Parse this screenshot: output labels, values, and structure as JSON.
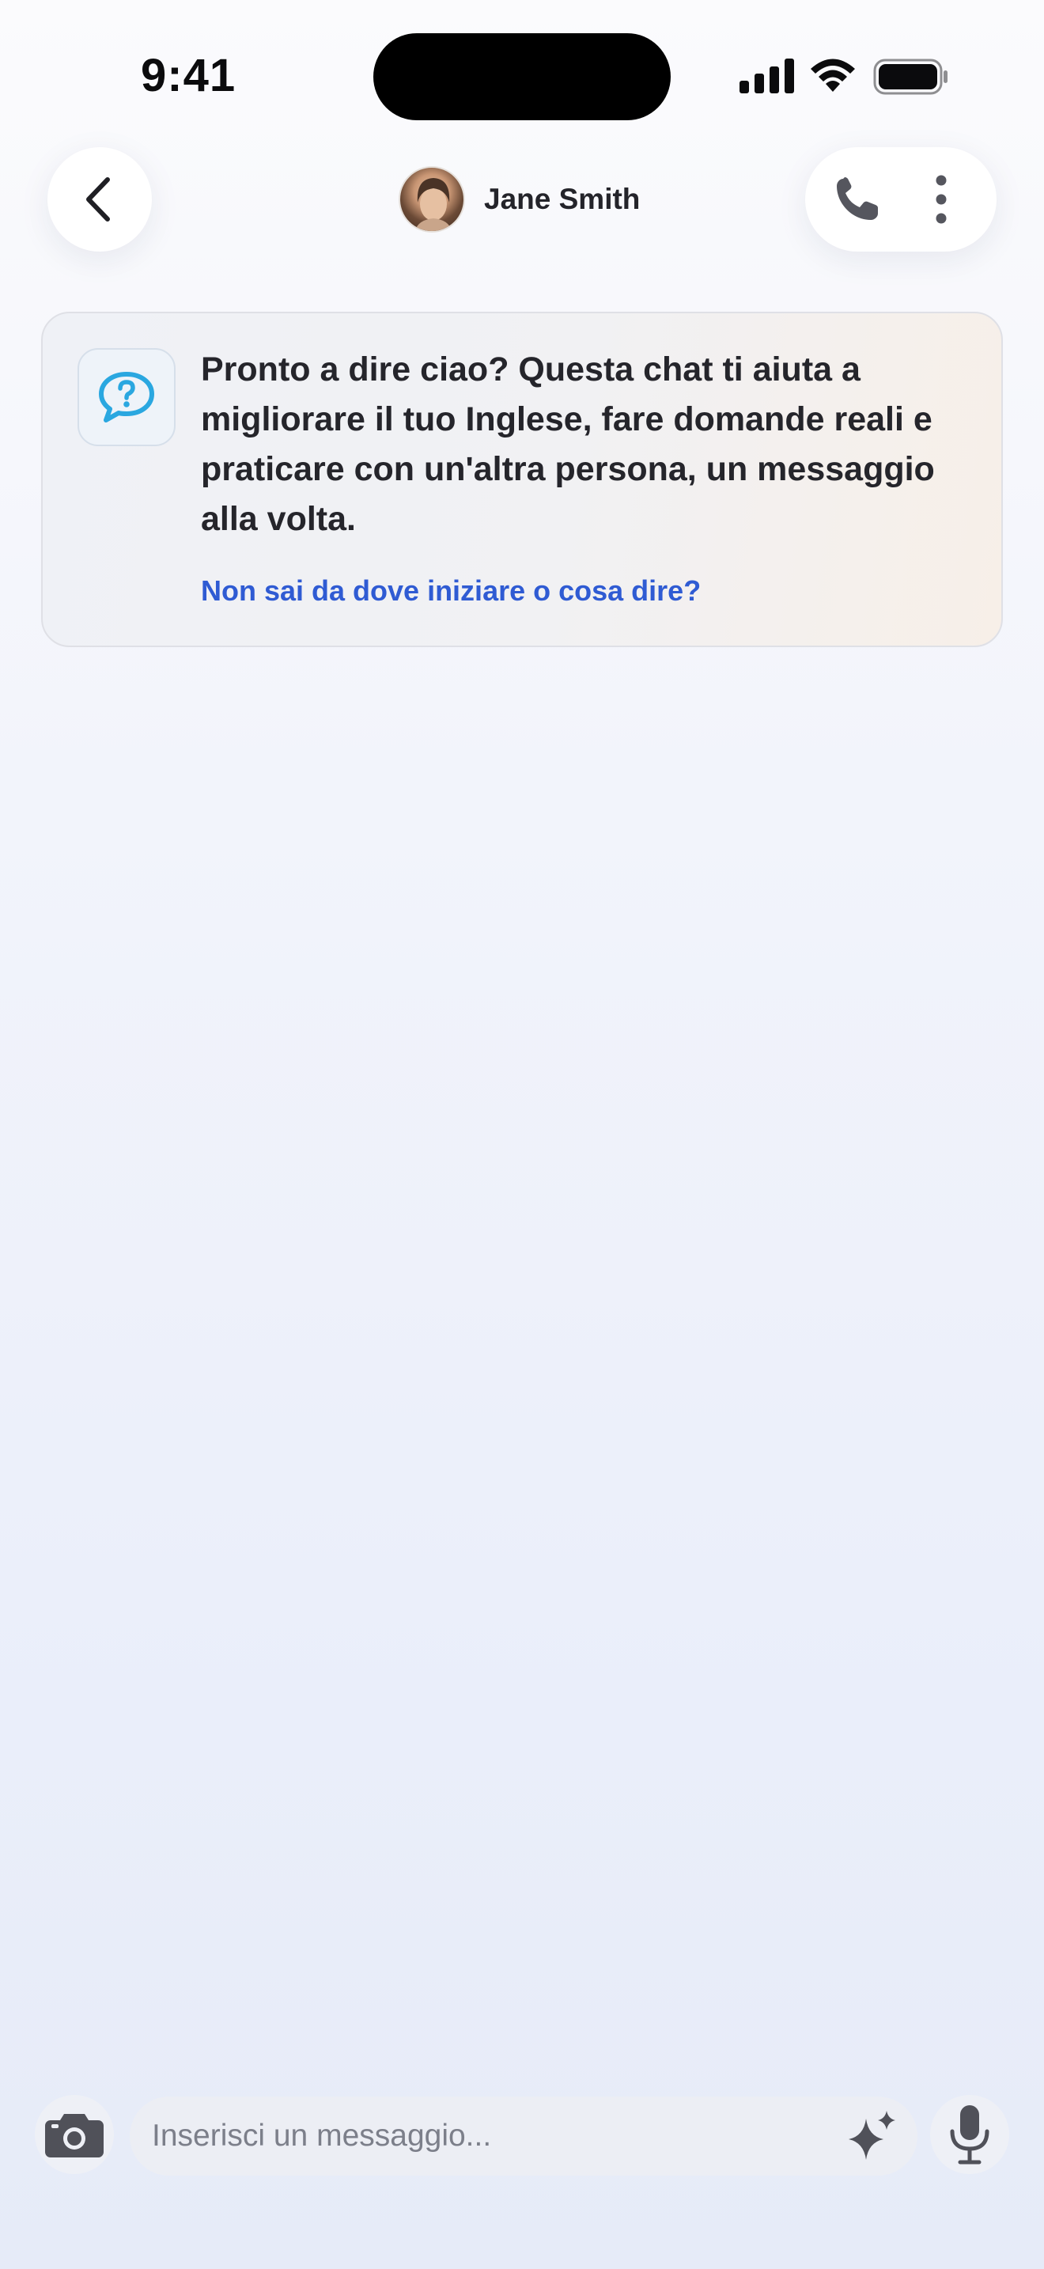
{
  "status_bar": {
    "time": "9:41",
    "icons": [
      "cellular-signal-icon",
      "wifi-icon",
      "battery-icon"
    ]
  },
  "header": {
    "back_icon": "chevron-left-icon",
    "contact_name": "Jane Smith",
    "call_icon": "phone-icon",
    "more_icon": "vertical-ellipsis-icon"
  },
  "intro_card": {
    "icon": "question-speech-bubble-icon",
    "message": "Pronto a dire ciao? Questa chat ti aiuta a migliorare il tuo Inglese, fare domande reali e praticare con un'altra persona, un messaggio alla volta.",
    "link": "Non sai da dove iniziare o cosa dire?"
  },
  "composer": {
    "camera_icon": "camera-icon",
    "placeholder": "Inserisci un messaggio...",
    "value": "",
    "ai_icon": "sparkles-icon",
    "mic_icon": "microphone-icon"
  },
  "colors": {
    "accent_link": "#2f5bd3",
    "intro_icon": "#2aa7e0",
    "icon_gray": "#55565e"
  }
}
